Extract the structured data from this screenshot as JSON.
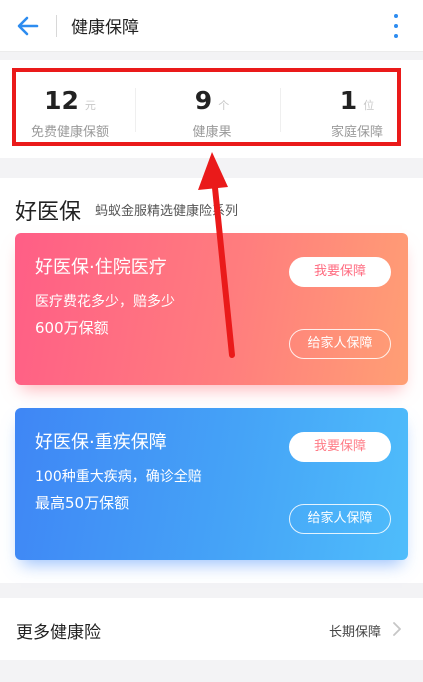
{
  "header": {
    "title": "健康保障"
  },
  "stats": [
    {
      "value": "12",
      "unit": "元",
      "label": "免费健康保额"
    },
    {
      "value": "9",
      "unit": "个",
      "label": "健康果"
    },
    {
      "value": "1",
      "unit": "位",
      "label": "家庭保障"
    }
  ],
  "section": {
    "title": "好医保",
    "subtitle": "蚂蚁金服精选健康险系列"
  },
  "cards": [
    {
      "title": "好医保·住院医疗",
      "line1": "医疗费花多少，赔多少",
      "line2": "600万保额",
      "primary": "我要保障",
      "secondary": "给家人保障"
    },
    {
      "title": "好医保·重疾保障",
      "line1": "100种重大疾病，确诊全赔",
      "line2": "最高50万保额",
      "primary": "我要保障",
      "secondary": "给家人保障"
    }
  ],
  "more": {
    "title": "更多健康险",
    "right": "长期保障"
  },
  "colors": {
    "accent": "#2d8cf0",
    "annotation": "#ea1a1a",
    "card1": "#ff6b80",
    "card2": "#45a3f7"
  },
  "icons": {
    "back": "back-arrow-icon",
    "more": "more-vertical-icon",
    "chevron": "chevron-right-icon"
  }
}
